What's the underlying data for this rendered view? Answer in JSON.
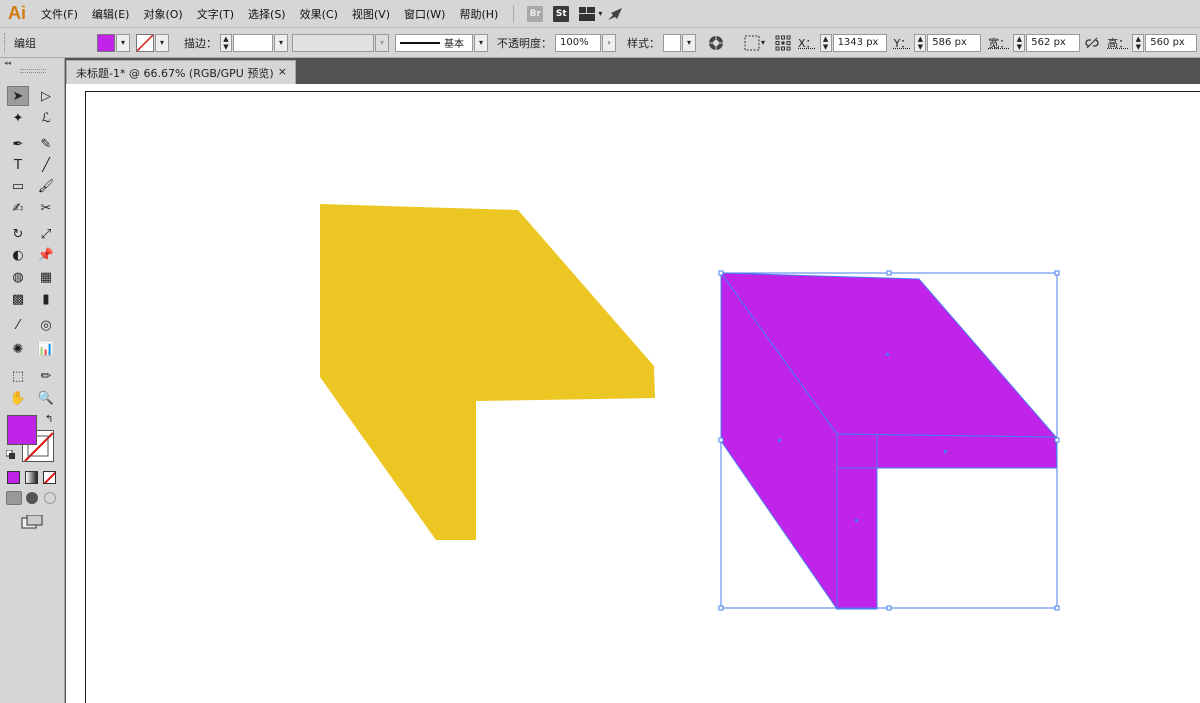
{
  "app": {
    "logo": "Ai"
  },
  "menu": [
    "文件(F)",
    "编辑(E)",
    "对象(O)",
    "文字(T)",
    "选择(S)",
    "效果(C)",
    "视图(V)",
    "窗口(W)",
    "帮助(H)"
  ],
  "menubar_icons": {
    "bridge": "Br",
    "stock": "St"
  },
  "control": {
    "selection_type": "编组",
    "fill_color": "#c024e8",
    "stroke_label": "描边：",
    "brush_label": "基本",
    "opacity_label": "不透明度：",
    "opacity_value": "100%",
    "style_label": "样式：",
    "x_label": "X：",
    "x_value": "1343 px",
    "y_label": "Y：",
    "y_value": "586 px",
    "w_label": "宽：",
    "w_value": "562 px",
    "h_label": "高：",
    "h_value": "560 px"
  },
  "document": {
    "tab_title": "未标题-1* @ 66.67% (RGB/GPU 预览)",
    "close_icon": "×"
  },
  "tools": [
    "selection",
    "direct-selection",
    "magic-wand",
    "lasso",
    "pen",
    "curvature",
    "type",
    "line-segment",
    "rectangle",
    "paintbrush",
    "shaper",
    "scissors",
    "rotate",
    "scale",
    "width",
    "puppet-warp",
    "shape-builder",
    "perspective-grid",
    "mesh",
    "gradient",
    "eyedropper",
    "blend",
    "symbol-sprayer",
    "column-graph",
    "artboard",
    "slice",
    "hand",
    "zoom"
  ],
  "tool_glyphs": [
    "➤",
    "▷",
    "✦",
    "ℒ",
    "✒",
    "✎",
    "T",
    "╱",
    "▭",
    "🖌",
    "✍",
    "✂",
    "↻",
    "⤢",
    "◐",
    "📌",
    "◍",
    "▦",
    "▩",
    "▮",
    "⁄",
    "◎",
    "✺",
    "📊",
    "⬚",
    "✏",
    "✋",
    "🔍"
  ],
  "colors": {
    "fill": "#c024e8",
    "yellow_shape": "#ecc622",
    "purple_shape": "#c024e8",
    "selection": "#4a7cf0"
  }
}
